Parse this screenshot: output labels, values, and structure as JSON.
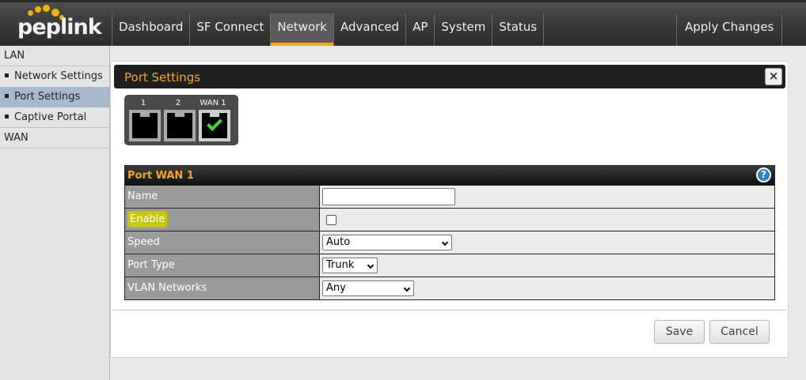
{
  "logo": {
    "text": "peplink"
  },
  "nav": {
    "items": [
      "Dashboard",
      "SF Connect",
      "Network",
      "Advanced",
      "AP",
      "System",
      "Status"
    ],
    "active": "Network",
    "apply_label": "Apply Changes"
  },
  "sidebar": {
    "sections": [
      {
        "heading": "LAN",
        "items": [
          "Network Settings",
          "Port Settings",
          "Captive Portal"
        ]
      },
      {
        "heading": "WAN",
        "items": []
      }
    ],
    "active_item": "Port Settings"
  },
  "dialog": {
    "title": "Port Settings",
    "close_label": "×",
    "ports": [
      {
        "label": "1",
        "selected": false
      },
      {
        "label": "2",
        "selected": false
      },
      {
        "label": "WAN 1",
        "selected": true
      }
    ],
    "form": {
      "title": "Port WAN 1",
      "help_label": "?",
      "fields": {
        "name": {
          "label": "Name",
          "value": ""
        },
        "enable": {
          "label": "Enable",
          "checked": false
        },
        "speed": {
          "label": "Speed",
          "value": "Auto"
        },
        "port_type": {
          "label": "Port Type",
          "value": "Trunk"
        },
        "vlan": {
          "label": "VLAN Networks",
          "value": "Any"
        }
      }
    },
    "save_label": "Save",
    "cancel_label": "Cancel"
  },
  "colors": {
    "accent": "#f5a623",
    "highlight": "#c8c800",
    "sidebar_active": "#a8b9cf",
    "check": "#3ddc2d"
  }
}
